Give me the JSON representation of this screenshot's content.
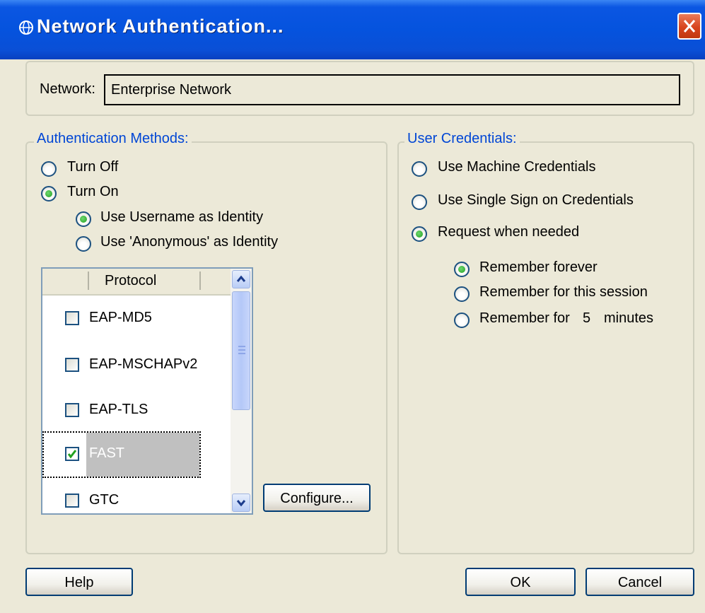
{
  "window": {
    "title": "Network Authentication...",
    "icon": "network-globe-icon",
    "close_icon": "close-icon"
  },
  "network": {
    "label": "Network:",
    "value": "Enterprise Network"
  },
  "auth": {
    "legend": "Authentication Methods:",
    "turn_off": "Turn Off",
    "turn_on": "Turn On",
    "use_username": "Use Username as Identity",
    "use_anonymous": "Use 'Anonymous' as Identity",
    "selected_mode": "Turn On",
    "selected_identity": "Use Username as Identity"
  },
  "protocols": {
    "header": "Protocol",
    "items": [
      {
        "label": "EAP-MD5",
        "checked": false
      },
      {
        "label": "EAP-MSCHAPv2",
        "checked": false
      },
      {
        "label": "EAP-TLS",
        "checked": false
      },
      {
        "label": "FAST",
        "checked": true
      },
      {
        "label": "GTC",
        "checked": false
      }
    ]
  },
  "configure_label": "Configure...",
  "credentials": {
    "legend": "User Credentials:",
    "machine": "Use Machine Credentials",
    "sso": "Use Single Sign on Credentials",
    "request": "Request when needed",
    "remember_forever": "Remember forever",
    "remember_session": "Remember for this session",
    "remember_for": "Remember for",
    "minutes_value": "5",
    "minutes_unit": "minutes",
    "selected": "Request when needed",
    "remember_selected": "Remember forever"
  },
  "buttons": {
    "help": "Help",
    "ok": "OK",
    "cancel": "Cancel"
  },
  "colors": {
    "title_bar": "#0553de",
    "legend_text": "#0046d5",
    "dialog_bg": "#ece9d8",
    "radio_dot": "#21a121"
  }
}
